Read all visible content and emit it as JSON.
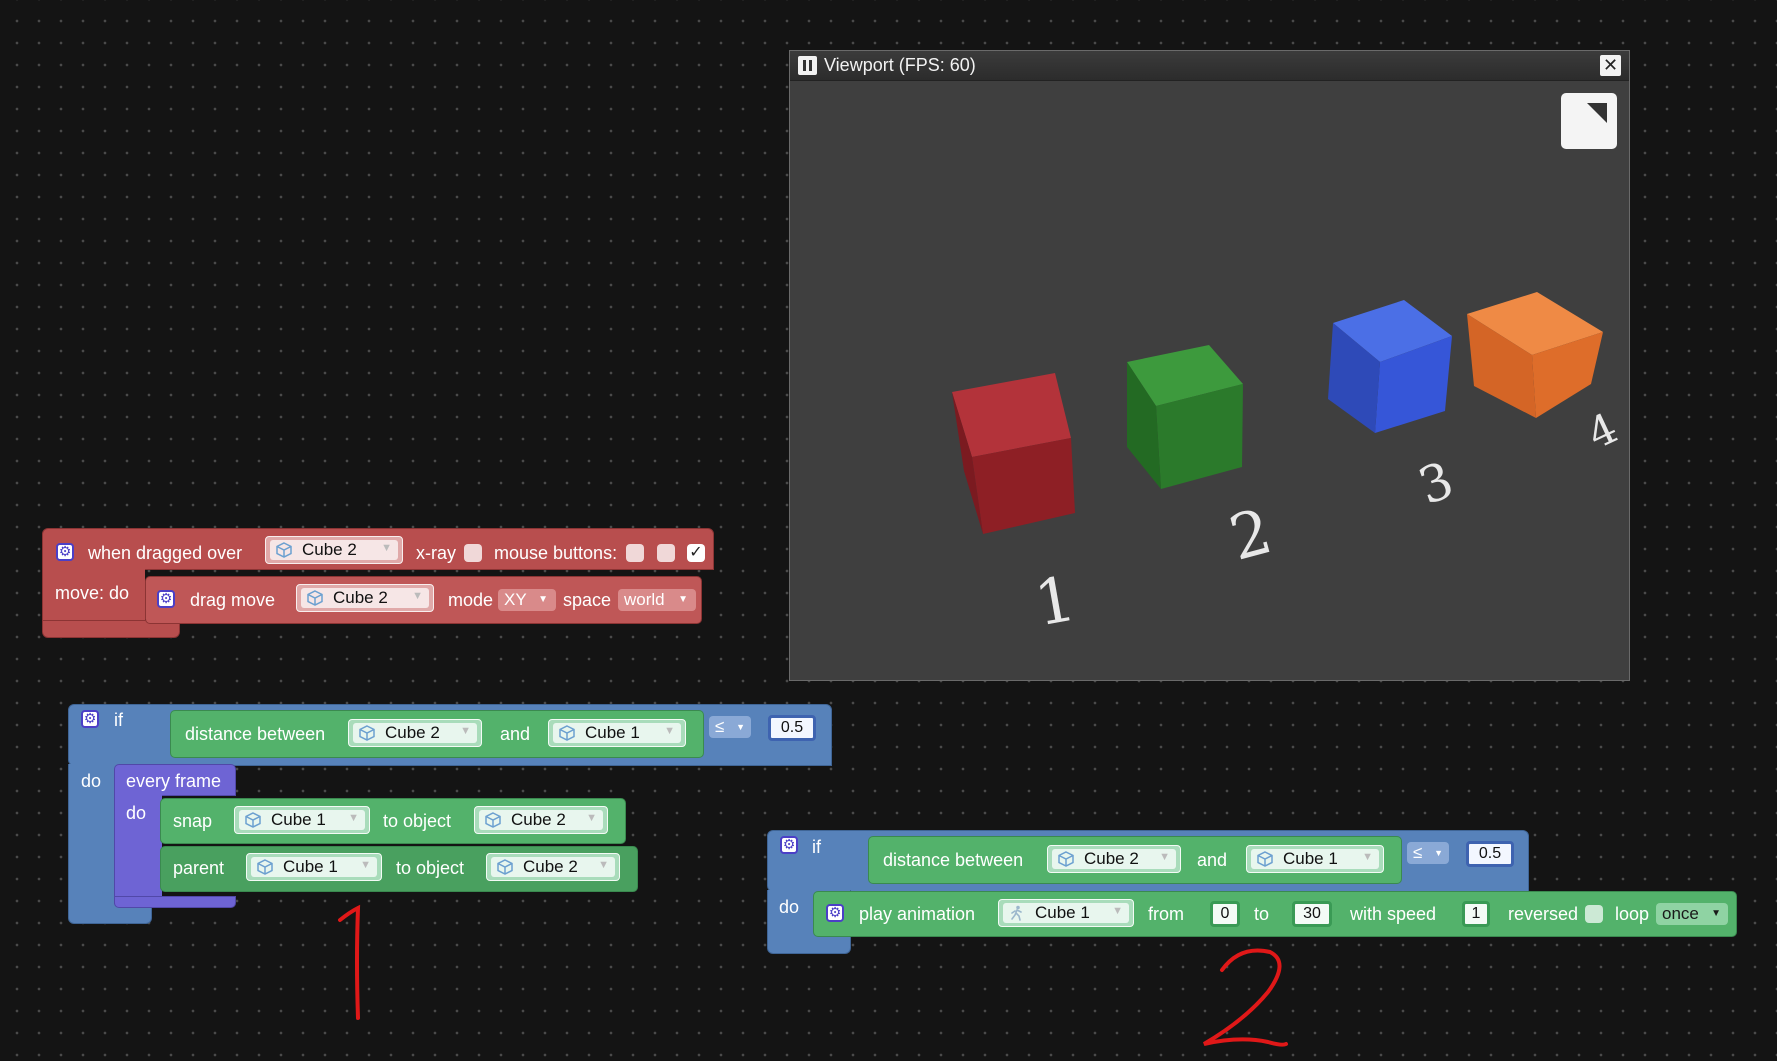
{
  "viewport": {
    "title": "Viewport (FPS: 60)",
    "close_glyph": "✕",
    "cube_labels": [
      "1",
      "2",
      "3"
    ],
    "cube_colors": [
      "#a3282c",
      "#2f8a2f",
      "#3556d6",
      "#e0722e"
    ]
  },
  "block_drag": {
    "when_label": "when dragged over",
    "target": "Cube 2",
    "xray_label": "x-ray",
    "mouse_label": "mouse buttons:",
    "check_mark": "✓",
    "move_do_label": "move: do",
    "drag_move_label": "drag move",
    "drag_target": "Cube 2",
    "mode_label": "mode",
    "mode_value": "XY",
    "space_label": "space",
    "space_value": "world"
  },
  "block_if1": {
    "if_label": "if",
    "distance_label": "distance between",
    "obj_a": "Cube 2",
    "and_label": "and",
    "obj_b": "Cube 1",
    "op": "≤",
    "threshold": "0.5",
    "do_label": "do",
    "every_frame_label": "every frame",
    "inner_do_label": "do",
    "snap_label": "snap",
    "snap_obj": "Cube 1",
    "to_object_label": "to object",
    "snap_target": "Cube 2",
    "parent_label": "parent",
    "parent_obj": "Cube 1",
    "parent_to_label": "to object",
    "parent_target": "Cube 2"
  },
  "block_if2": {
    "if_label": "if",
    "distance_label": "distance between",
    "obj_a": "Cube 2",
    "and_label": "and",
    "obj_b": "Cube 1",
    "op": "≤",
    "threshold": "0.5",
    "do_label": "do",
    "play_label": "play animation",
    "anim_obj": "Cube 1",
    "from_label": "from",
    "from_value": "0",
    "to_label": "to",
    "to_value": "30",
    "speed_label": "with speed",
    "speed_value": "1",
    "reversed_label": "reversed",
    "loop_label": "loop",
    "loop_value": "once"
  },
  "annotations": {
    "mark_1": "1",
    "mark_2": "2",
    "color": "#e01818"
  }
}
